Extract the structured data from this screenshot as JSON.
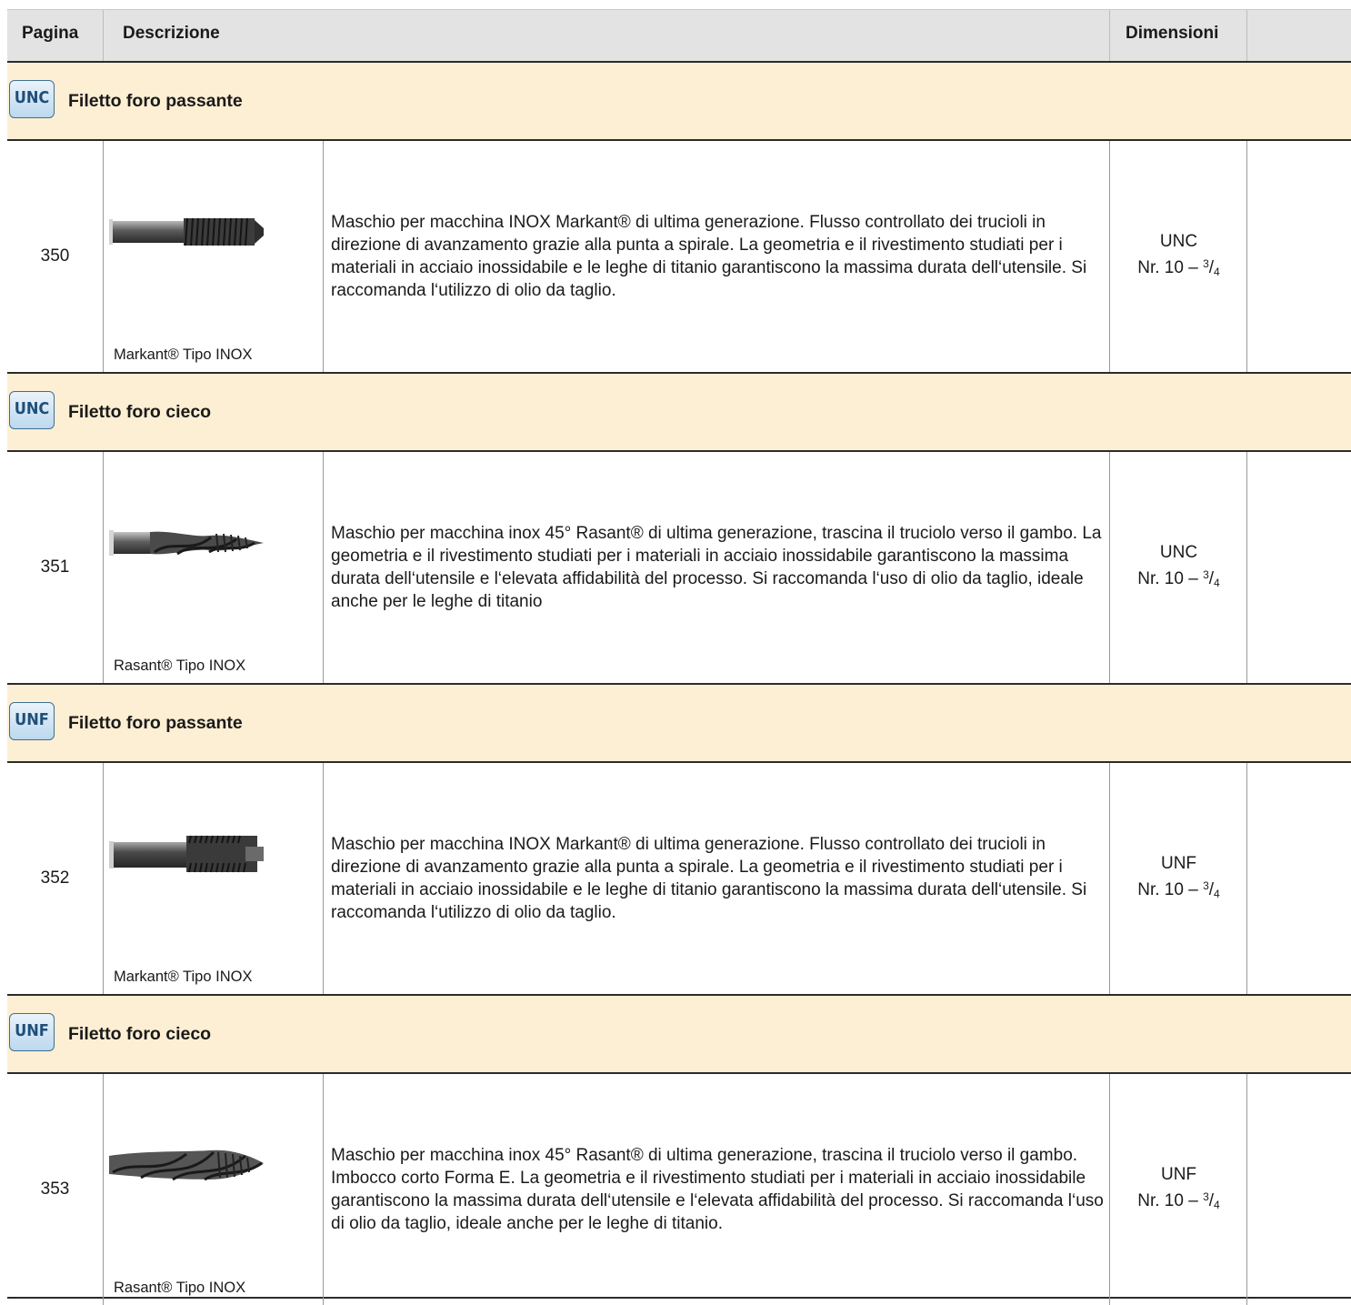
{
  "header": {
    "col_page": "Pagina",
    "col_description": "Descrizione",
    "col_dimensions": "Dimensioni"
  },
  "sections": [
    {
      "badge": "UNC",
      "title": "Filetto foro passante",
      "product": {
        "page": "350",
        "caption": "Markant® Tipo INOX",
        "tool_icon": "spiral-point-tap-image",
        "description": "Maschio per macchina INOX Markant® di ultima generazione. Flusso controllato dei trucioli in direzione di avanzamento grazie alla punta a spirale. La geometria e il rivestimento studiati per i materiali in acciaio inossidabile e le leghe di titanio garantiscono la massima durata dell‘utensile. Si raccomanda l‘utilizzo di olio da taglio.",
        "dim_standard": "UNC",
        "dim_range_prefix": "Nr. 10 – ",
        "dim_frac_num": "3",
        "dim_frac_den": "4"
      }
    },
    {
      "badge": "UNC",
      "title": "Filetto foro cieco",
      "product": {
        "page": "351",
        "caption": "Rasant® Tipo INOX",
        "tool_icon": "spiral-flute-tap-image",
        "description": "Maschio per macchina inox 45° Rasant® di ultima generazione, trascina il truciolo verso il gambo. La geometria e il rivestimento studiati per i materiali in acciaio inossidabile garantiscono la massima durata dell‘utensile e l‘elevata affidabilità del processo. Si raccomanda l‘uso di olio da taglio, ideale anche per le leghe di titanio",
        "dim_standard": "UNC",
        "dim_range_prefix": "Nr. 10 – ",
        "dim_frac_num": "3",
        "dim_frac_den": "4"
      }
    },
    {
      "badge": "UNF",
      "title": "Filetto foro passante",
      "product": {
        "page": "352",
        "caption": "Markant® Tipo INOX",
        "tool_icon": "spiral-point-tap-image",
        "description": "Maschio per macchina INOX Markant® di ultima generazione. Flusso controllato dei trucioli in direzione di avanzamento grazie alla punta a spirale. La geometria e il rivestimento studiati per i materiali in acciaio inossidabile e le leghe di titanio garantiscono la massima durata dell‘utensile. Si raccomanda l‘utilizzo di olio da taglio.",
        "dim_standard": "UNF",
        "dim_range_prefix": "Nr. 10 – ",
        "dim_frac_num": "3",
        "dim_frac_den": "4"
      }
    },
    {
      "badge": "UNF",
      "title": "Filetto foro cieco",
      "product": {
        "page": "353",
        "caption": "Rasant® Tipo INOX",
        "tool_icon": "spiral-flute-tap-image",
        "description": "Maschio per macchina inox 45° Rasant® di ultima generazione, trascina il truciolo verso il gambo. Imbocco corto Forma E. La geometria e il rivestimento studiati per i materiali in acciaio inossidabile garantiscono la massima durata dell‘utensile e l‘elevata affidabilità del processo. Si raccomanda l‘uso di olio da taglio, ideale anche per le leghe di titanio.",
        "dim_standard": "UNF",
        "dim_range_prefix": "Nr. 10 – ",
        "dim_frac_num": "3",
        "dim_frac_den": "4"
      }
    }
  ]
}
